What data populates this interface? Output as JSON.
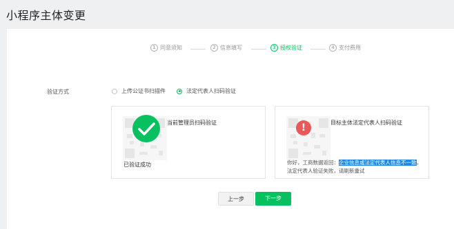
{
  "page_title": "小程序主体变更",
  "steps": [
    {
      "num": "1",
      "label": "同意须知"
    },
    {
      "num": "2",
      "label": "信息填写"
    },
    {
      "num": "3",
      "label": "授权验证"
    },
    {
      "num": "4",
      "label": "支付费用"
    }
  ],
  "active_step": 3,
  "verify": {
    "label": "验证方式",
    "options": [
      "上传公证书扫描件",
      "法定代表人扫码验证"
    ],
    "selected": 1
  },
  "cards": {
    "admin": {
      "title": "当前管理员扫码验证",
      "status": "已验证成功",
      "badge_icon": "check-icon"
    },
    "legal_rep": {
      "title": "目标主体法定代表人扫码验证",
      "badge_icon": "error-icon",
      "badge_glyph": "!",
      "message_prefix": "你好，工商数据返回：",
      "message_highlight": "企业信息或法定代表人信息不一致",
      "message_suffix": "，法定代表人验证失败，请刷新重试"
    }
  },
  "buttons": {
    "prev": "上一步",
    "next": "下一步"
  },
  "colors": {
    "accent": "#07c160",
    "error": "#e9595a",
    "highlight": "#1e88e5"
  }
}
